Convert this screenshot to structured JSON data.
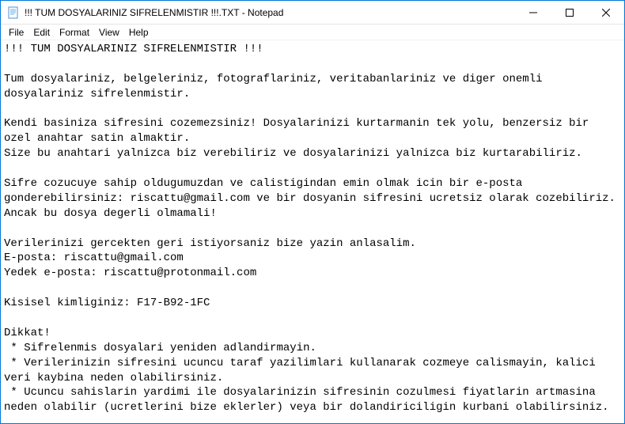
{
  "window": {
    "title": "!!! TUM DOSYALARINIZ SIFRELENMISTIR !!!.TXT - Notepad"
  },
  "menu": {
    "file": "File",
    "edit": "Edit",
    "format": "Format",
    "view": "View",
    "help": "Help"
  },
  "document": {
    "text": "!!! TUM DOSYALARINIZ SIFRELENMISTIR !!!\n\nTum dosyalariniz, belgeleriniz, fotograflariniz, veritabanlariniz ve diger onemli dosyalariniz sifrelenmistir.\n\nKendi basiniza sifresini cozemezsiniz! Dosyalarinizi kurtarmanin tek yolu, benzersiz bir ozel anahtar satin almaktir.\nSize bu anahtari yalnizca biz verebiliriz ve dosyalarinizi yalnizca biz kurtarabiliriz.\n\nSifre cozucuye sahip oldugumuzdan ve calistigindan emin olmak icin bir e-posta gonderebilirsiniz: riscattu@gmail.com ve bir dosyanin sifresini ucretsiz olarak cozebiliriz.\nAncak bu dosya degerli olmamali!\n\nVerilerinizi gercekten geri istiyorsaniz bize yazin anlasalim.\nE-posta: riscattu@gmail.com\nYedek e-posta: riscattu@protonmail.com\n\nKisisel kimliginiz: F17-B92-1FC\n\nDikkat!\n * Sifrelenmis dosyalari yeniden adlandirmayin.\n * Verilerinizin sifresini ucuncu taraf yazilimlari kullanarak cozmeye calismayin, kalici veri kaybina neden olabilirsiniz.\n * Ucuncu sahislarin yardimi ile dosyalarinizin sifresinin cozulmesi fiyatlarin artmasina neden olabilir (ucretlerini bize eklerler) veya bir dolandiriciligin kurbani olabilirsiniz."
  }
}
